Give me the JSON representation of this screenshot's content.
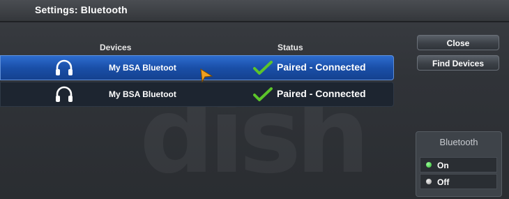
{
  "titlebar": {
    "title": "Settings:  Bluetooth"
  },
  "table": {
    "headers": {
      "devices": "Devices",
      "status": "Status"
    },
    "rows": [
      {
        "device": "My BSA Bluetoot",
        "status": "Paired - Connected",
        "icon": "headphones-icon",
        "selected": true
      },
      {
        "device": "My BSA Bluetoot",
        "status": "Paired - Connected",
        "icon": "headphones-icon",
        "selected": false
      }
    ]
  },
  "buttons": {
    "close": "Close",
    "find_devices": "Find Devices"
  },
  "bluetooth_panel": {
    "title": "Bluetooth",
    "options": [
      {
        "label": "On",
        "active": true
      },
      {
        "label": "Off",
        "active": false
      }
    ]
  },
  "watermark": "dish",
  "colors": {
    "selected_row": "#1f56b5",
    "row": "#1d2530",
    "check": "#5cc42a",
    "cursor": "#f0a020",
    "on_indicator": "#2cb52c"
  }
}
